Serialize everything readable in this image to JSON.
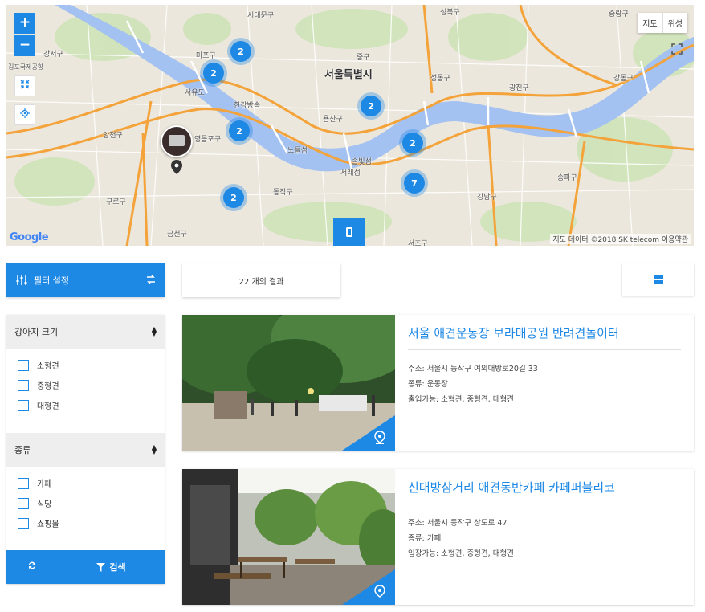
{
  "map": {
    "title_district": "서울특별시",
    "labels": [
      {
        "t": "서대문구"
      },
      {
        "t": "마포구"
      },
      {
        "t": "강서구"
      },
      {
        "t": "김포국제공항"
      },
      {
        "t": "서유도"
      },
      {
        "t": "한강방송"
      },
      {
        "t": "용산구"
      },
      {
        "t": "중구"
      },
      {
        "t": "성동구"
      },
      {
        "t": "광진구"
      },
      {
        "t": "강동구"
      },
      {
        "t": "영등포구"
      },
      {
        "t": "양천구"
      },
      {
        "t": "노들섬"
      },
      {
        "t": "동작구"
      },
      {
        "t": "서래섬"
      },
      {
        "t": "구로구"
      },
      {
        "t": "강남구"
      },
      {
        "t": "송파구"
      },
      {
        "t": "금천구"
      },
      {
        "t": "서초구"
      },
      {
        "t": "성북구"
      },
      {
        "t": "중랑구"
      },
      {
        "t": "솔빛섬"
      }
    ],
    "clusters": [
      {
        "count": "2"
      },
      {
        "count": "2"
      },
      {
        "count": "2"
      },
      {
        "count": "2"
      },
      {
        "count": "2"
      },
      {
        "count": "2"
      },
      {
        "count": "7"
      }
    ],
    "zoom_in": "+",
    "zoom_out": "−",
    "map_type_map": "지도",
    "map_type_satellite": "위성",
    "google_logo": "Google",
    "attribution": "지도 데이터 ©2018 SK telecom  이용약관",
    "colors": {
      "accent": "#1e88e5",
      "water": "#a3c1f1",
      "road": "#f3a33a"
    }
  },
  "filter": {
    "header_label": "필터 설정",
    "result_count": "22 개의 결과",
    "sections": [
      {
        "title": "강아지 크기",
        "options": [
          "소형견",
          "중형견",
          "대형견"
        ]
      },
      {
        "title": "종류",
        "options": [
          "카페",
          "식당",
          "쇼핑몰"
        ]
      }
    ],
    "search_label": "검색"
  },
  "cards": [
    {
      "title": "서울 애견운동장 보라매공원 반려견놀이터",
      "address": "주소: 서울시 동작구 여의대방로20길 33",
      "type": "종류: 운동장",
      "access": "출입가능: 소형견, 중형견, 대형견"
    },
    {
      "title": "신대방삼거리 애견동반카페 카페퍼블리코",
      "address": "주소: 서울시 동작구 상도로 47",
      "type": "종류: 카페",
      "access": "입장가능: 소형견, 중형견, 대형견"
    }
  ]
}
